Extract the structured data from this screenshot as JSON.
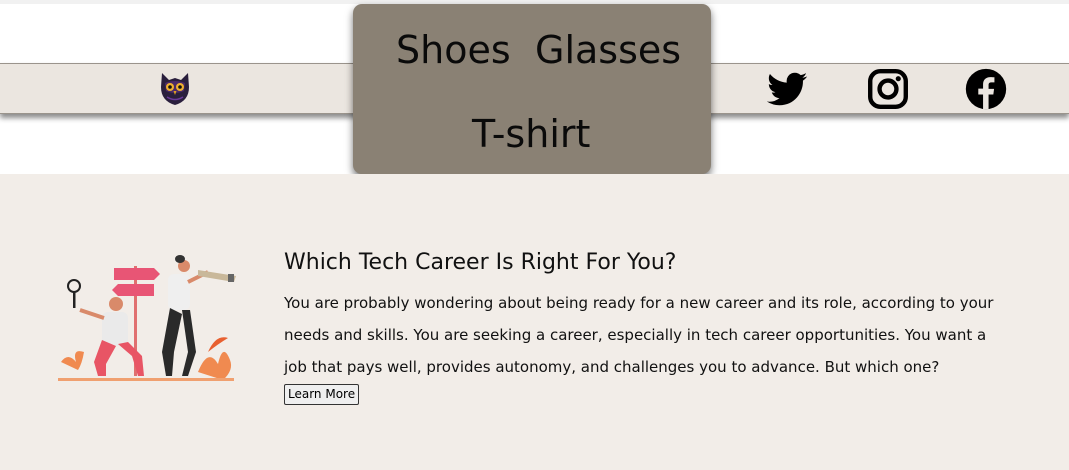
{
  "nav": {
    "menu": [
      "Shoes",
      "Glasses",
      "T-shirt"
    ],
    "social": [
      "twitter-icon",
      "instagram-icon",
      "facebook-icon"
    ]
  },
  "career": {
    "title": "Which Tech Career Is Right For You?",
    "body": "You are probably wondering about being ready for a new career and its role, according to your needs and skills. You are seeking a career, especially in tech career opportunities. You want a job that pays well, provides autonomy, and challenges you to advance. But which one?",
    "button": "Learn More"
  },
  "colors": {
    "navbar_bg": "#ebe6e0",
    "menu_bg": "#8a8174",
    "section_bg": "#f2ede8"
  }
}
